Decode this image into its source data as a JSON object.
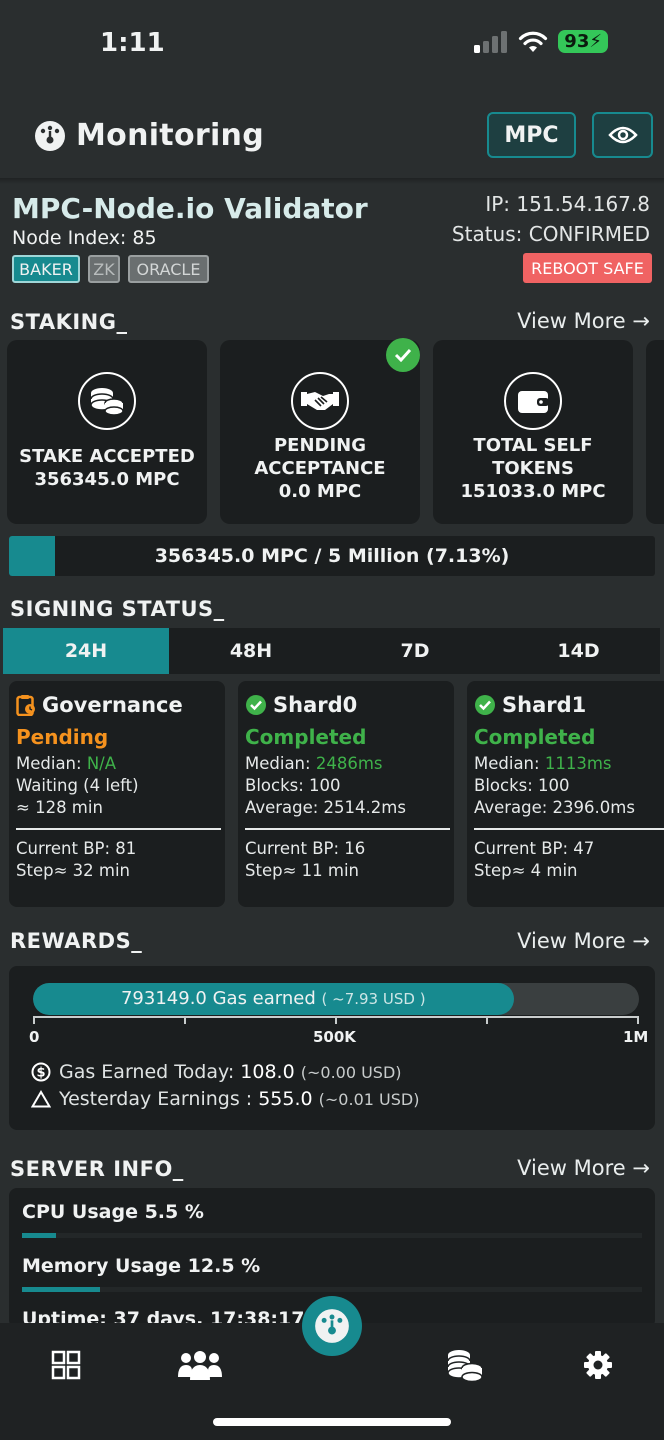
{
  "status_bar": {
    "time": "1:11",
    "battery": "93"
  },
  "header": {
    "title": "Monitoring",
    "token_button": "MPC"
  },
  "node": {
    "name": "MPC-Node.io Validator",
    "index_label": "Node Index: 85",
    "tags": [
      "BAKER",
      "ZK",
      "ORACLE"
    ],
    "ip": "IP: 151.54.167.8",
    "status": "Status: CONFIRMED",
    "reboot": "REBOOT SAFE"
  },
  "staking": {
    "title": "STAKING_",
    "view_more": "View More",
    "cards": [
      {
        "line1": "STAKE ACCEPTED",
        "line2": "356345.0 MPC",
        "line3": ""
      },
      {
        "line1": "PENDING",
        "line2": "ACCEPTANCE",
        "line3": "0.0 MPC"
      },
      {
        "line1": "TOTAL SELF",
        "line2": "TOKENS",
        "line3": "151033.0 MPC"
      }
    ],
    "progress_text": "356345.0 MPC / 5 Million (7.13%)",
    "progress_fraction": 0.0713
  },
  "signing": {
    "title": "SIGNING STATUS_",
    "tabs": [
      "24H",
      "48H",
      "7D",
      "14D"
    ],
    "active_tab": "24H",
    "cards": [
      {
        "name": "Governance",
        "state": "Pending",
        "median_label": "Median: ",
        "median_value": "N/A",
        "line2": "Waiting (4 left)",
        "line3": "≈ 128 min",
        "bp": "Current BP: 81",
        "step": "Step≈ 32 min"
      },
      {
        "name": "Shard0",
        "state": "Completed",
        "median_label": "Median: ",
        "median_value": "2486ms",
        "line2": "Blocks: 100",
        "line3": "Average: 2514.2ms",
        "bp": "Current BP: 16",
        "step": "Step≈ 11 min"
      },
      {
        "name": "Shard1",
        "state": "Completed",
        "median_label": "Median: ",
        "median_value": "1113ms",
        "line2": "Blocks: 100",
        "line3": "Average: 2396.0ms",
        "bp": "Current BP: 47",
        "step": "Step≈ 4 min"
      }
    ]
  },
  "rewards": {
    "title": "REWARDS_",
    "view_more": "View More",
    "gas_earned": "793149.0 Gas earned",
    "gas_usd": "( ~7.93 USD )",
    "gas_fraction": 0.793,
    "axis_labels": [
      "0",
      "500K",
      "1M"
    ],
    "today_label": "Gas Earned Today: ",
    "today_value": "108.0",
    "today_usd": "(~0.00 USD)",
    "yesterday_label": "Yesterday Earnings : ",
    "yesterday_value": "555.0",
    "yesterday_usd": "(~0.01 USD)"
  },
  "server": {
    "title": "SERVER INFO_",
    "view_more": "View More",
    "cpu_label": "CPU Usage 5.5 %",
    "cpu_fraction": 0.055,
    "memory_label": "Memory Usage 12.5 %",
    "memory_fraction": 0.125,
    "uptime_label": "Uptime: 37 days, 17:38:17"
  },
  "colors": {
    "accent": "#178a8f",
    "pending": "#f5921e",
    "completed": "#3fb24a",
    "reboot": "#f06363"
  }
}
